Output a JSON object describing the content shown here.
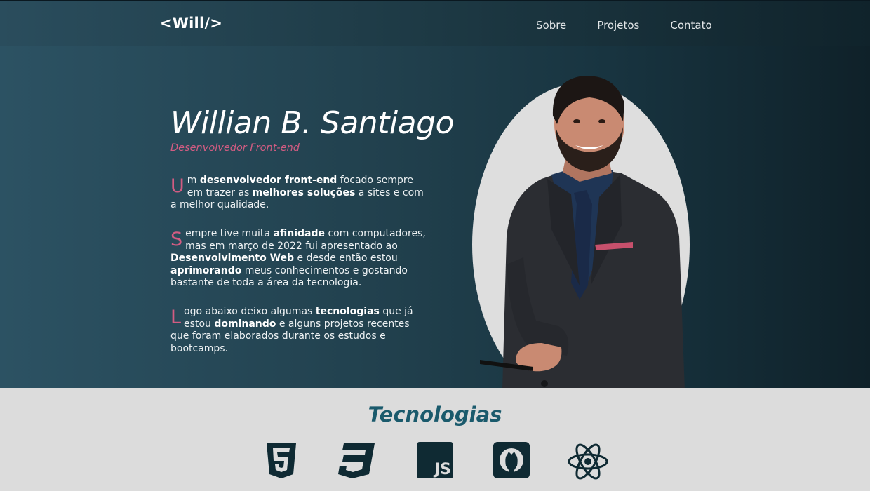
{
  "header": {
    "logo": "<Will/>",
    "nav": [
      {
        "label": "Sobre"
      },
      {
        "label": "Projetos"
      },
      {
        "label": "Contato"
      }
    ]
  },
  "hero": {
    "name": "Willian B. Santiago",
    "role": "Desenvolvedor Front-end",
    "paragraphs": [
      {
        "drop": "U",
        "t1": "m ",
        "b1": "desenvolvedor front-end",
        "t2": " focado sempre em trazer as ",
        "b2": "melhores soluções",
        "t3": " a sites e com a melhor qualidade.",
        "b3": "",
        "t4": ""
      },
      {
        "drop": "S",
        "t1": "empre tive muita ",
        "b1": "afinidade",
        "t2": " com computadores, mas em março de 2022 fui apresentado ao ",
        "b2": "Desenvolvimento Web",
        "t3": " e desde então estou ",
        "b3": "aprimorando",
        "t4": " meus conhecimentos e gostando bastante de toda a área da tecnologia."
      },
      {
        "drop": "L",
        "t1": "ogo abaixo deixo algumas ",
        "b1": "tecnologias",
        "t2": " que já estou ",
        "b2": "dominando",
        "t3": " e alguns projetos recentes que foram elaborados durante os estudos e bootcamps.",
        "b3": "",
        "t4": ""
      }
    ]
  },
  "tech": {
    "title": "Tecnologias",
    "js_label": "JS",
    "icons": [
      "html5-icon",
      "css3-icon",
      "javascript-icon",
      "github-icon",
      "react-icon"
    ]
  },
  "colors": {
    "accent_pink": "#d25c82",
    "teal_title": "#1a5a6c",
    "icon_dark": "#0f2a33",
    "light_bg": "#dcdcdc"
  }
}
